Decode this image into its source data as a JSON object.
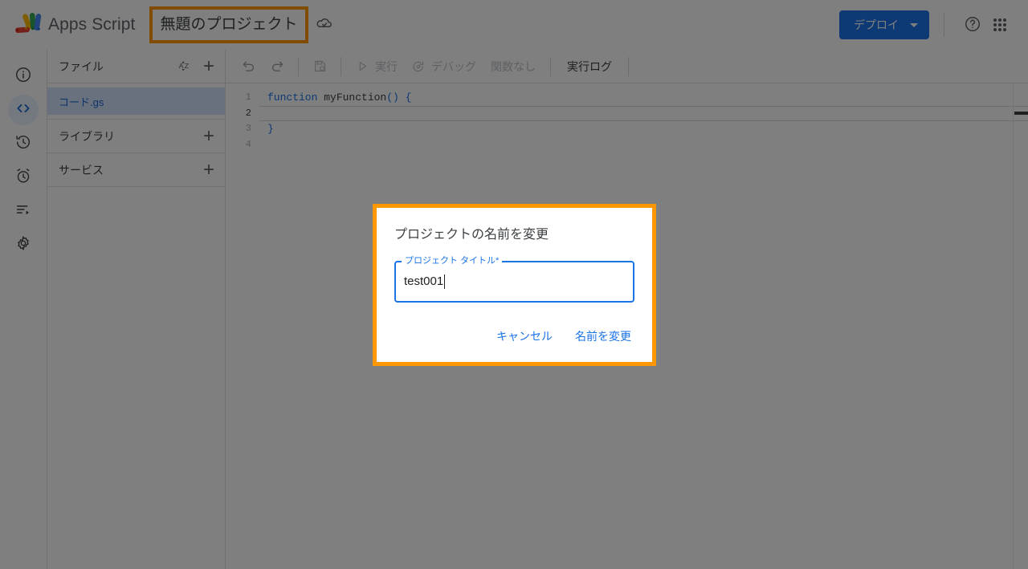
{
  "header": {
    "logo_name": "apps-script-logo",
    "brand": "Apps Script",
    "project_title": "無題のプロジェクト",
    "cloud_icon": "cloud-check-icon",
    "deploy_label": "デプロイ",
    "help_icon": "help-circle-icon",
    "apps_icon": "apps-grid-icon",
    "accent_color": "#1a73e8",
    "highlight_color": "#FF9800"
  },
  "rail": {
    "items": [
      {
        "name": "overview",
        "icon": "info-circle-icon",
        "active": false
      },
      {
        "name": "editor",
        "icon": "code-brackets-icon",
        "active": true
      },
      {
        "name": "history",
        "icon": "history-clock-icon",
        "active": false
      },
      {
        "name": "triggers",
        "icon": "alarm-clock-icon",
        "active": false
      },
      {
        "name": "executions",
        "icon": "executions-list-icon",
        "active": false
      },
      {
        "name": "settings",
        "icon": "gear-icon",
        "active": false
      }
    ]
  },
  "file_panel": {
    "files_header": "ファイル",
    "sort_icon": "sort-az-icon",
    "add_icon": "plus-icon",
    "files": [
      {
        "name": "コード.gs",
        "selected": true
      }
    ],
    "libraries_header": "ライブラリ",
    "services_header": "サービス"
  },
  "toolbar": {
    "undo_icon": "undo-icon",
    "redo_icon": "redo-icon",
    "save_icon": "save-icon",
    "run_icon": "play-triangle-icon",
    "run_label": "実行",
    "debug_icon": "debug-bug-icon",
    "debug_label": "デバッグ",
    "function_select": "関数なし",
    "exec_log_label": "実行ログ"
  },
  "editor": {
    "line_numbers": [
      "1",
      "2",
      "3",
      "4"
    ],
    "current_line": 2,
    "code_lines": [
      {
        "n": 1,
        "keyword": "function",
        "rest": " myFunction",
        "parens": "()",
        "brace": " {"
      },
      {
        "n": 2,
        "plain": "  "
      },
      {
        "n": 3,
        "brace_close": "}"
      },
      {
        "n": 4,
        "plain": ""
      }
    ]
  },
  "dialog": {
    "title": "プロジェクトの名前を変更",
    "field_label": "プロジェクト タイトル*",
    "field_value": "test001",
    "field_placeholder": "プロジェクト タイトル",
    "cancel_label": "キャンセル",
    "confirm_label": "名前を変更"
  }
}
